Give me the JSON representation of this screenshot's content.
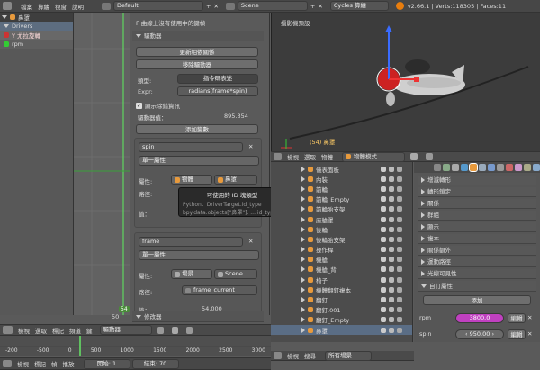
{
  "topbar": {
    "menus": [
      "檔案",
      "算繪",
      "視窗",
      "說明"
    ],
    "layout": "Default",
    "scene": "Scene",
    "engine": "Cycles 算繪",
    "status": "v2.66.1 | Verts:118305 | Faces:11"
  },
  "channels": {
    "object": "鼻罩",
    "drivers": "Drivers",
    "items": [
      "Y 尤拉旋轉",
      "rpm"
    ]
  },
  "drivers_panel": {
    "no_keyframe": "F 曲線上沒有使用中的鍵幀",
    "section_driver": "驅動器",
    "update_deps": "更新相依關係",
    "remove_driver": "移除驅動器",
    "type_label": "類型:",
    "type_value": "指令碼表述",
    "expr_label": "Expr:",
    "expr_value": "radians(frame*spin)",
    "show_debug": "顯示除錯資訊",
    "driver_value_label": "驅動器值：",
    "driver_value": "895.354",
    "add_variable": "添加變數",
    "var1": {
      "name": "spin",
      "type": "單一屬性",
      "prop_label": "屬性:",
      "id_type": "物體",
      "id_name": "鼻罩",
      "path_label": "路徑:",
      "value_label": "值："
    },
    "var2": {
      "name": "frame",
      "type": "單一屬性",
      "prop_label": "屬性:",
      "id_type": "場景",
      "id_name": "Scene",
      "path_label": "路徑:",
      "path_value": "frame_current",
      "value_label": "值：",
      "value": "54.000"
    },
    "modifiers": "修改器"
  },
  "tooltip": {
    "title": "可使用的 ID 塊類型",
    "python": "Python：DriverTarget.id_type",
    "code": "bpy.data.objects[\"鼻罩\"]. ... id_type"
  },
  "graph": {
    "current_frame": "54",
    "ruler_label": "50"
  },
  "viewport": {
    "title": "攝影機預設",
    "object_label": "(54) 鼻罩",
    "header": [
      "檢視",
      "選取",
      "物體"
    ],
    "mode": "物體模式"
  },
  "outliner": {
    "header": [
      "檢視",
      "搜尋"
    ],
    "filter": "所有場景",
    "items": [
      "儀表面板",
      "內裝",
      "前輪",
      "前輪_Empty",
      "前輪胎支架",
      "座艙罩",
      "後輪",
      "後輪胎支架",
      "操作桿",
      "機艙",
      "機艙_背",
      "椅子",
      "機體翻釘複本",
      "翻釘",
      "翻釘.001",
      "翻釘_Empty",
      "鼻罩"
    ]
  },
  "properties": {
    "sections": [
      "增減轉形",
      "轉形鎖定",
      "關係",
      "群組",
      "顯示",
      "複本",
      "關係額外",
      "運動路徑",
      "光線可見性"
    ],
    "custom_props": "自訂屬性",
    "add": "添加",
    "props": [
      {
        "name": "rpm",
        "value": "3800.0",
        "edit": "編輯"
      },
      {
        "name": "spin",
        "value": "950.00",
        "edit": "編輯"
      }
    ]
  },
  "timeline": {
    "menus": [
      "檢視",
      "選取",
      "標記",
      "頻道",
      "鍵"
    ],
    "mode": "驅動器",
    "ticks": [
      "-200",
      "-500",
      "0",
      "500",
      "1000",
      "1500",
      "2000",
      "2500",
      "3000"
    ],
    "bottom_menus": [
      "檢視",
      "標記",
      "幀",
      "播放"
    ],
    "start_label": "開始: 1",
    "end_label": "結束: 70"
  }
}
